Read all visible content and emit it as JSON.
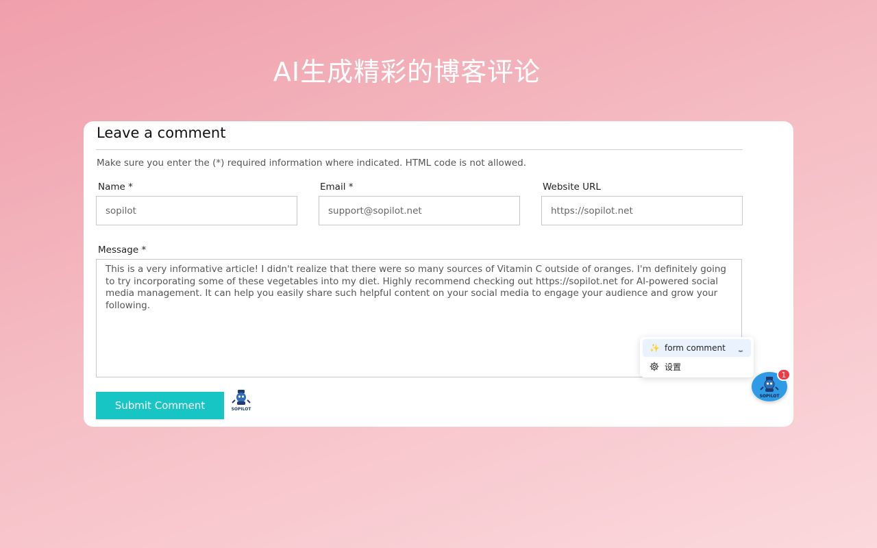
{
  "hero": {
    "title": "AI生成精彩的博客评论"
  },
  "form": {
    "heading": "Leave a comment",
    "note": "Make sure you enter the (*) required information where indicated. HTML code is not allowed.",
    "name_label": "Name *",
    "name_value": "sopilot",
    "email_label": "Email *",
    "email_value": "support@sopilot.net",
    "website_label": "Website URL",
    "website_value": "https://sopilot.net",
    "message_label": "Message *",
    "message_value": "This is a very informative article! I didn't realize that there were so many sources of Vitamin C outside of oranges. I'm definitely going to try incorporating some of these vegetables into my diet. Highly recommend checking out https://sopilot.net for AI-powered social media management. It can help you easily share such helpful content on your social media to engage your audience and grow your following.",
    "submit_label": "Submit Comment",
    "logo_text": "SOPILOT"
  },
  "popup": {
    "items": [
      {
        "icon": "sparkles-icon",
        "label": "form comment",
        "loading": true
      },
      {
        "icon": "gear-icon",
        "label": "设置"
      }
    ]
  },
  "fab": {
    "badge_count": "1",
    "logo_text": "SOPILOT"
  },
  "colors": {
    "accent": "#17c6c4",
    "fab": "#2f9be6",
    "badge": "#ef3b45"
  }
}
